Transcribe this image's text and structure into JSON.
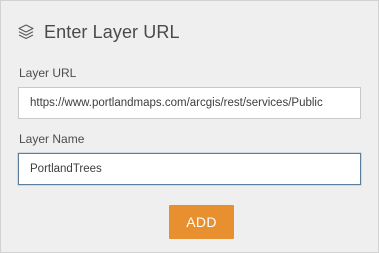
{
  "header": {
    "icon": "layers-icon",
    "title": "Enter Layer URL"
  },
  "form": {
    "url_label": "Layer URL",
    "url_value": "https://www.portlandmaps.com/arcgis/rest/services/Public",
    "name_label": "Layer Name",
    "name_value": "PortlandTrees"
  },
  "actions": {
    "add_label": "ADD"
  },
  "colors": {
    "panel_background": "#efefef",
    "accent_button": "#e8902f",
    "focus_border": "#5a7e9b"
  }
}
